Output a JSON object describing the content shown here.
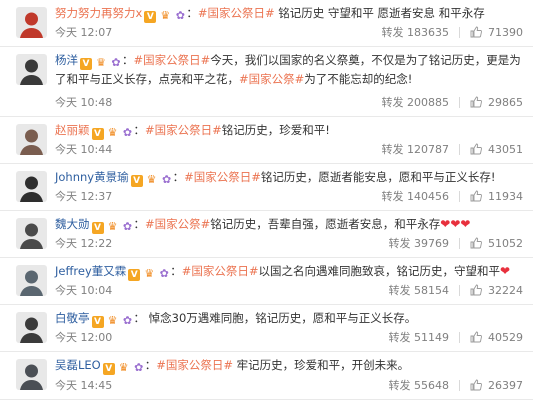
{
  "repost_label": "转发",
  "comments": [
    {
      "user": "努力努力再努力x",
      "name_style": "orange",
      "segments": [
        {
          "t": "#国家公祭日#",
          "topic": true
        },
        {
          "t": " 铭记历史 守望和平 愿逝者安息 和平永存"
        }
      ],
      "time": "今天 12:07",
      "reposts": "183635",
      "likes": "71390"
    },
    {
      "user": "杨洋",
      "name_style": "blue",
      "segments": [
        {
          "t": "#国家公祭日#",
          "topic": true
        },
        {
          "t": "今天，我们以国家的名义祭奠，不仅是为了铭记历史，更是为了和平与正义长存，点亮和平之花，"
        },
        {
          "t": "#国家公祭#",
          "topic": true
        },
        {
          "t": "为了不能忘却的纪念!"
        }
      ],
      "time": "今天 10:48",
      "reposts": "200885",
      "likes": "29865"
    },
    {
      "user": "赵丽颖",
      "name_style": "orange",
      "segments": [
        {
          "t": "#国家公祭日#",
          "topic": true
        },
        {
          "t": "铭记历史，珍爱和平!"
        }
      ],
      "time": "今天 10:44",
      "reposts": "120787",
      "likes": "43051"
    },
    {
      "user": "Johnny黄景瑜",
      "name_style": "blue",
      "segments": [
        {
          "t": "#国家公祭日#",
          "topic": true
        },
        {
          "t": "铭记历史，愿逝者能安息，愿和平与正义长存!"
        }
      ],
      "time": "今天 12:37",
      "reposts": "140456",
      "likes": "11934"
    },
    {
      "user": "魏大勋",
      "name_style": "blue",
      "segments": [
        {
          "t": "#国家公祭#",
          "topic": true
        },
        {
          "t": "铭记历史，吾辈自强，愿逝者安息，和平永存"
        },
        {
          "t": "❤❤❤",
          "heart": true
        }
      ],
      "time": "今天 12:22",
      "reposts": "39769",
      "likes": "51052"
    },
    {
      "user": "Jeffrey董又霖",
      "name_style": "blue",
      "segments": [
        {
          "t": "#国家公祭日#",
          "topic": true
        },
        {
          "t": "以国之名向遇难同胞致哀，铭记历史，守望和平"
        },
        {
          "t": "❤",
          "heart": true
        }
      ],
      "time": "今天 10:04",
      "reposts": "58154",
      "likes": "32224"
    },
    {
      "user": "白敬亭",
      "name_style": "blue",
      "segments": [
        {
          "t": " 悼念30万遇难同胞，铭记历史，愿和平与正义长存。"
        }
      ],
      "time": "今天 12:00",
      "reposts": "51149",
      "likes": "40529"
    },
    {
      "user": "吴磊LEO",
      "name_style": "blue",
      "segments": [
        {
          "t": "#国家公祭日#",
          "topic": true
        },
        {
          "t": " 牢记历史，珍爱和平，开创未来。"
        }
      ],
      "time": "今天 14:45",
      "reposts": "55648",
      "likes": "26397"
    }
  ]
}
